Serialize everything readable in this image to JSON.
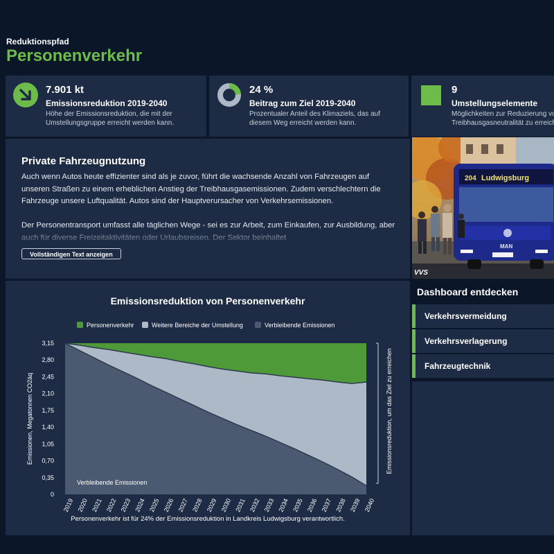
{
  "header": {
    "eyebrow": "Reduktionspfad",
    "title": "Personenverkehr"
  },
  "kpis": [
    {
      "value": "7.901 kt",
      "label": "Emissionsreduktion 2019-2040",
      "desc_line1": "Höhe der Emissionsreduktion, die mit der",
      "desc_line2": "Umstellungsgruppe erreicht werden kann.",
      "icon": "arrow-down-right-icon"
    },
    {
      "value": "24 %",
      "label": "Beitrag zum Ziel 2019-2040",
      "desc_line1": "Prozentualer Anteil des Klimaziels, das auf",
      "desc_line2": "diesem Weg erreicht werden kann.",
      "icon": "donut-icon",
      "share": 0.24
    },
    {
      "value": "9",
      "label": "Umstellungselemente",
      "desc_line1": "Möglichkeiten zur Reduzierung von",
      "desc_line2": "Treibhausgasneutralität zu erreichen",
      "icon": "square-icon"
    }
  ],
  "intro": {
    "title": "Private Fahrzeugnutzung",
    "paragraph1": "Auch wenn Autos heute effizienter sind als je zuvor, führt die wachsende Anzahl von Fahrzeugen auf unseren Straßen zu einem erheblichen Anstieg der Treibhausgasemissionen. Zudem verschlechtern die Fahrzeuge unsere Luftqualität. Autos sind der Hauptverursacher von Verkehrsemissionen.",
    "paragraph2": "Der Personentransport umfasst alle täglichen Wege - sei es zur Arbeit, zum Einkaufen, zur Ausbildung, aber auch für diverse Freizeitaktivitäten oder Urlaubsreisen. Der Sektor beinhaltet",
    "button": "Vollständigen Text anzeigen"
  },
  "photo": {
    "bus_sign": "Ludwigsburg",
    "bus_number": "204",
    "bus_brand": "MAN",
    "watermark": "VVS"
  },
  "colors": {
    "background": "#0b1628",
    "card": "#1d2b44",
    "accent": "#6dbb4a",
    "personenverkehr": "#4e9a38",
    "weitere": "#aeb9c7",
    "verbleibend": "#4b5a70"
  },
  "chart_data": {
    "type": "area",
    "title": "Emissionsreduktion von Personenverkehr",
    "subtitle": "Personenverkehr ist für 24% der Emissionsreduktion in Landkreis Ludwigsburg verantwortlich.",
    "ylabel": "Emissionen, Megatonnen CO2äq",
    "y2label": "Emissionsreduktion, um das Ziel zu erreichen",
    "area_label": "Verbleibende Emissionen",
    "ylim": [
      0,
      3.15
    ],
    "yticks": [
      "0",
      "0,35",
      "0,70",
      "1,05",
      "1,40",
      "1,75",
      "2,10",
      "2,45",
      "2,80",
      "3,15"
    ],
    "x": [
      "2019",
      "2020",
      "2021",
      "2022",
      "2023",
      "2024",
      "2025",
      "2026",
      "2027",
      "2028",
      "2029",
      "2030",
      "2031",
      "2032",
      "2033",
      "2034",
      "2035",
      "2036",
      "2037",
      "2038",
      "2039",
      "2040"
    ],
    "legend_position": "top",
    "series": [
      {
        "name": "Verbleibende Emissionen",
        "values": [
          3.15,
          3.0,
          2.85,
          2.7,
          2.56,
          2.42,
          2.27,
          2.13,
          1.99,
          1.85,
          1.71,
          1.58,
          1.45,
          1.33,
          1.21,
          1.08,
          0.95,
          0.81,
          0.67,
          0.52,
          0.36,
          0.18
        ]
      },
      {
        "name": "Weitere Bereiche der Umstellung",
        "values": [
          0,
          0.11,
          0.21,
          0.32,
          0.41,
          0.5,
          0.6,
          0.7,
          0.78,
          0.87,
          0.95,
          1.03,
          1.12,
          1.2,
          1.3,
          1.39,
          1.49,
          1.6,
          1.71,
          1.82,
          1.95,
          2.16
        ]
      },
      {
        "name": "Personenverkehr",
        "values": [
          0,
          0.04,
          0.09,
          0.13,
          0.18,
          0.23,
          0.28,
          0.32,
          0.38,
          0.43,
          0.49,
          0.54,
          0.58,
          0.62,
          0.64,
          0.68,
          0.71,
          0.74,
          0.77,
          0.81,
          0.84,
          0.81
        ]
      }
    ]
  },
  "explore": {
    "title": "Dashboard entdecken",
    "items": [
      "Verkehrsvermeidung",
      "Verkehrsverlagerung",
      "Fahrzeugtechnik"
    ]
  }
}
